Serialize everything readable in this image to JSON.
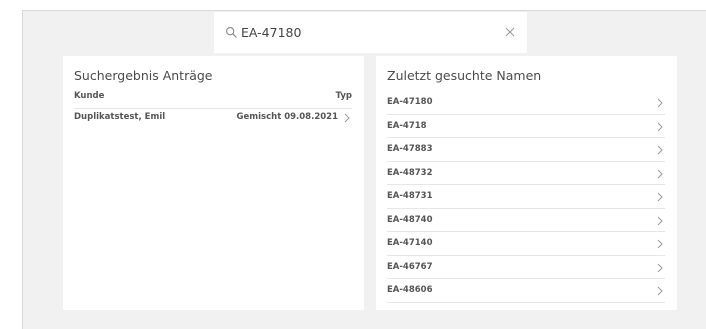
{
  "search": {
    "value": "EA-47180",
    "placeholder": ""
  },
  "results": {
    "title": "Suchergebnis Anträge",
    "col_customer": "Kunde",
    "col_type": "Typ",
    "rows": [
      {
        "customer": "Duplikatstest, Emil",
        "type_date": "Gemischt 09.08.2021"
      }
    ]
  },
  "recent": {
    "title": "Zuletzt gesuchte Namen",
    "items": [
      "EA-47180",
      "EA-4718",
      "EA-47883",
      "EA-48732",
      "EA-48731",
      "EA-48740",
      "EA-47140",
      "EA-46767",
      "EA-48606"
    ]
  },
  "colors": {
    "background": "#f1f1f1",
    "panel": "#ffffff",
    "divider": "#e6e6e6",
    "chevron": "#9a9a9a"
  }
}
